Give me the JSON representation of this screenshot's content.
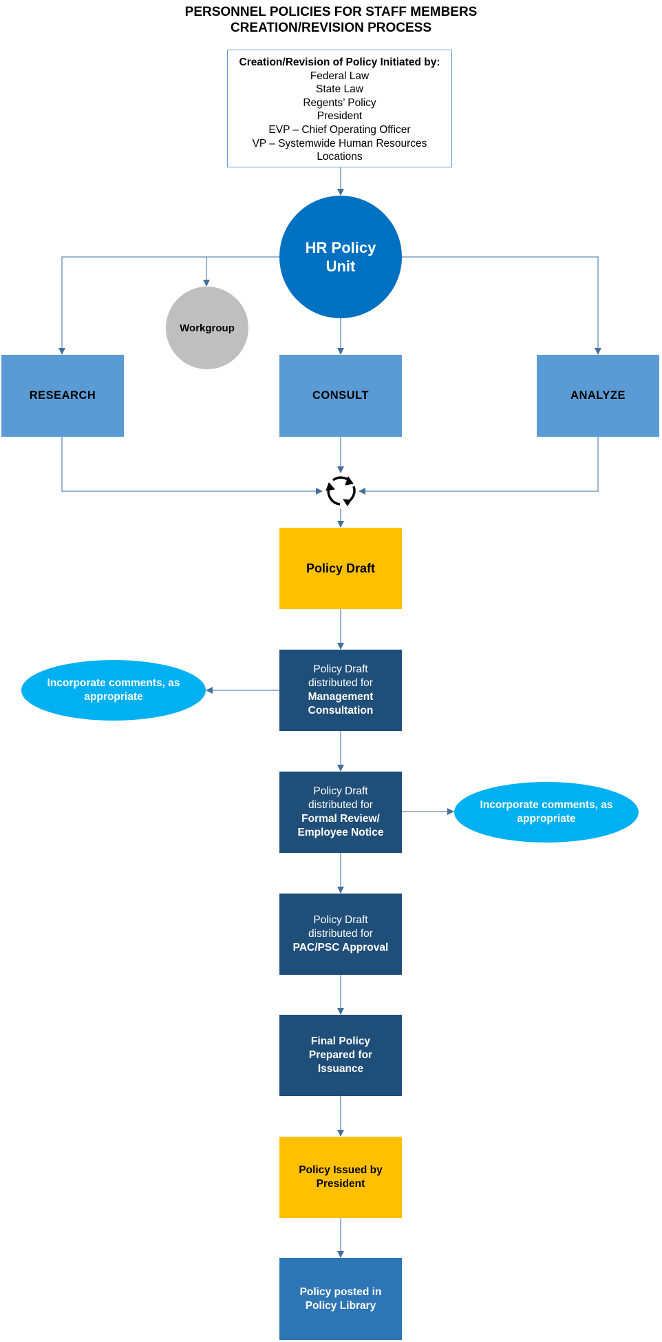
{
  "title": {
    "line1": "PERSONNEL POLICIES FOR STAFF MEMBERS",
    "line2": "CREATION/REVISION PROCESS"
  },
  "initiators": {
    "heading": "Creation/Revision of Policy Initiated by:",
    "items": [
      "Federal Law",
      "State Law",
      "Regents’ Policy",
      "President",
      "EVP – Chief Operating Officer",
      "VP – Systemwide Human Resources",
      "Locations"
    ]
  },
  "hr_unit": {
    "line1": "HR Policy",
    "line2": "Unit"
  },
  "workgroup": "Workgroup",
  "activities": {
    "research": "RESEARCH",
    "consult": "CONSULT",
    "analyze": "ANALYZE"
  },
  "cycle_icon": "refresh-cycle-icon",
  "policy_draft": "Policy Draft",
  "management": {
    "line1": "Policy Draft",
    "line2": "distributed for",
    "bold1": "Management",
    "bold2": "Consultation"
  },
  "comments_left": "Incorporate comments, as appropriate",
  "formal": {
    "line1": "Policy Draft",
    "line2": "distributed for",
    "bold1": "Formal Review/",
    "bold2": "Employee Notice"
  },
  "comments_right": "Incorporate comments, as appropriate",
  "pac": {
    "line1": "Policy Draft",
    "line2": "distributed for",
    "bold1": "PAC/PSC Approval"
  },
  "final": {
    "line1": "Final Policy",
    "line2": "Prepared for",
    "line3": "Issuance"
  },
  "issued": {
    "line1": "Policy Issued by",
    "line2": "President"
  },
  "library": {
    "line1": "Policy posted in",
    "line2": "Policy Library"
  },
  "colors": {
    "connector": "#41719c",
    "hr_unit": "#0070c0",
    "workgroup": "#bfbfbf",
    "activity": "#5b9bd5",
    "yellow": "#ffc000",
    "navy": "#1f4e79",
    "library": "#2e75b6",
    "comments": "#00b0f0"
  }
}
